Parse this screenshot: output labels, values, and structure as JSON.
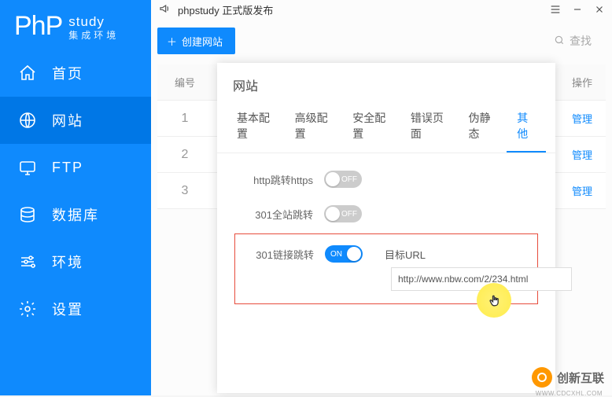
{
  "brand": {
    "main": "PhP",
    "sub1": "study",
    "sub2": "集成环境"
  },
  "titlebar": {
    "announcement": "phpstudy 正式版发布"
  },
  "sidebar": {
    "items": [
      {
        "label": "首页"
      },
      {
        "label": "网站"
      },
      {
        "label": "FTP"
      },
      {
        "label": "数据库"
      },
      {
        "label": "环境"
      },
      {
        "label": "设置"
      }
    ]
  },
  "toolbar": {
    "create": "创建网站",
    "search": "查找"
  },
  "table": {
    "head_num": "编号",
    "head_op": "操作",
    "rows": [
      {
        "num": "1",
        "op": "管理"
      },
      {
        "num": "2",
        "op": "管理"
      },
      {
        "num": "3",
        "op": "管理"
      }
    ]
  },
  "dialog": {
    "title": "网站",
    "tabs": [
      "基本配置",
      "高级配置",
      "安全配置",
      "错误页面",
      "伪静态",
      "其他"
    ],
    "active_tab": 5,
    "opt_http_https": "http跳转https",
    "opt_301_site": "301全站跳转",
    "opt_301_link": "301链接跳转",
    "off": "OFF",
    "on": "ON",
    "target_label": "目标URL",
    "target_value": "http://www.nbw.com/2/234.html"
  },
  "watermark": {
    "text": "创新互联",
    "sub": "WWW.CDCXHL.COM"
  }
}
